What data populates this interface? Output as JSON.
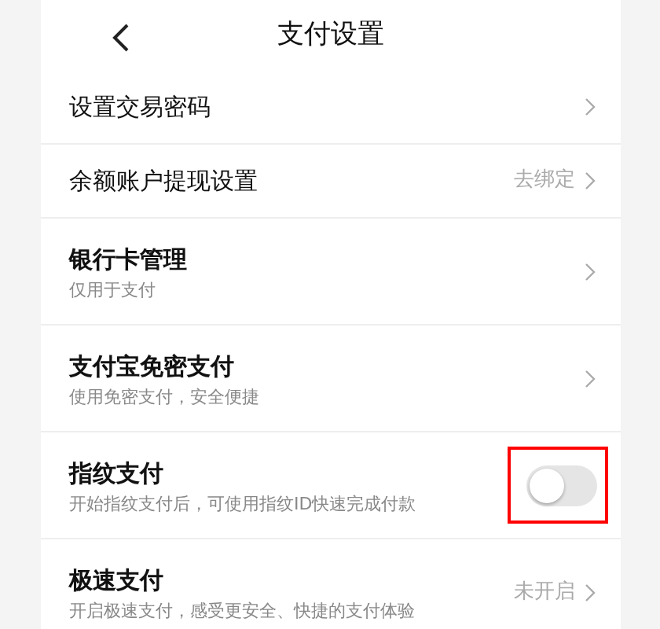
{
  "header": {
    "title": "支付设置"
  },
  "rows": [
    {
      "kind": "link",
      "title": "设置交易密码"
    },
    {
      "kind": "link",
      "title": "余额账户提现设置",
      "value": "去绑定"
    },
    {
      "kind": "link",
      "title": "银行卡管理",
      "subtitle": "仅用于支付"
    },
    {
      "kind": "link",
      "title": "支付宝免密支付",
      "subtitle": "使用免密支付，安全便捷"
    },
    {
      "kind": "toggle",
      "title": "指纹支付",
      "subtitle": "开始指纹支付后，可使用指纹ID快速完成付款",
      "on": false,
      "highlighted": true
    },
    {
      "kind": "link",
      "title": "极速支付",
      "subtitle": "开启极速支付，感受更安全、快捷的支付体验",
      "value": "未开启"
    }
  ]
}
